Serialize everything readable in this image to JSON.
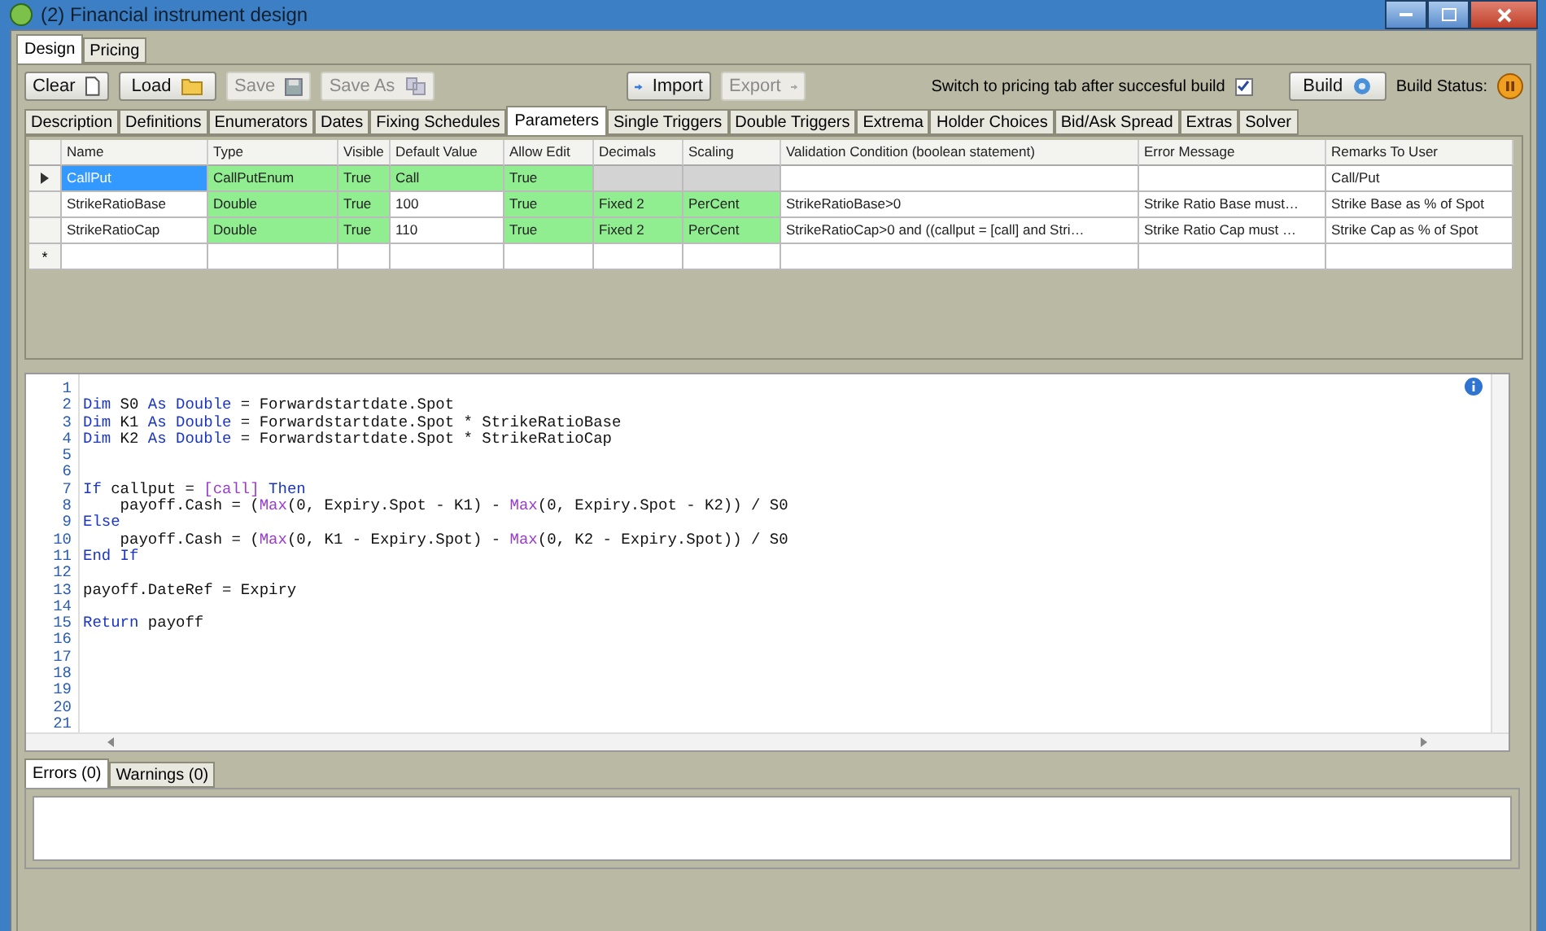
{
  "window": {
    "title": "(2) Financial instrument design"
  },
  "main_tabs": [
    {
      "label": "Design",
      "selected": true
    },
    {
      "label": "Pricing",
      "selected": false
    }
  ],
  "toolbar": {
    "buttons": [
      {
        "label": "Clear",
        "disabled": false
      },
      {
        "label": "Load",
        "disabled": false
      },
      {
        "label": "Save",
        "disabled": true
      },
      {
        "label": "Save As",
        "disabled": true
      },
      {
        "label": "Import",
        "disabled": false
      },
      {
        "label": "Export",
        "disabled": true
      }
    ],
    "switch_label": "Switch to pricing tab after succesful build",
    "switch_checked": true,
    "build_button": "Build",
    "build_status_label": "Build Status:"
  },
  "sub_tabs": [
    {
      "label": "Description",
      "selected": false
    },
    {
      "label": "Definitions",
      "selected": false
    },
    {
      "label": "Enumerators",
      "selected": false
    },
    {
      "label": "Dates",
      "selected": false
    },
    {
      "label": "Fixing Schedules",
      "selected": false
    },
    {
      "label": "Parameters",
      "selected": true
    },
    {
      "label": "Single Triggers",
      "selected": false
    },
    {
      "label": "Double Triggers",
      "selected": false
    },
    {
      "label": "Extrema",
      "selected": false
    },
    {
      "label": "Holder Choices",
      "selected": false
    },
    {
      "label": "Bid/Ask Spread",
      "selected": false
    },
    {
      "label": "Extras",
      "selected": false
    },
    {
      "label": "Solver",
      "selected": false
    }
  ],
  "grid": {
    "columns": [
      "Name",
      "Type",
      "Visible",
      "Default Value",
      "Allow Edit",
      "Decimals",
      "Scaling",
      "Validation Condition (boolean statement)",
      "Error Message",
      "Remarks To User"
    ],
    "rows": [
      {
        "selected": true,
        "cells": [
          {
            "text": "CallPut",
            "kind": "plain"
          },
          {
            "text": "CallPutEnum",
            "kind": "green"
          },
          {
            "text": "True",
            "kind": "green"
          },
          {
            "text": "Call",
            "kind": "green"
          },
          {
            "text": "True",
            "kind": "green"
          },
          {
            "kind": "grey"
          },
          {
            "kind": "grey"
          },
          {
            "kind": "plain"
          },
          {
            "kind": "plain"
          },
          {
            "text": "Call/Put",
            "kind": "plain"
          }
        ]
      },
      {
        "selected": false,
        "cells": [
          {
            "text": "StrikeRatioBase",
            "kind": "plain"
          },
          {
            "text": "Double",
            "kind": "green"
          },
          {
            "text": "True",
            "kind": "green"
          },
          {
            "text": "100",
            "kind": "plain"
          },
          {
            "text": "True",
            "kind": "green"
          },
          {
            "text": "Fixed 2",
            "kind": "green"
          },
          {
            "text": "PerCent",
            "kind": "green"
          },
          {
            "text": "StrikeRatioBase>0",
            "kind": "plain"
          },
          {
            "text": "Strike Ratio Base must…",
            "kind": "plain"
          },
          {
            "text": "Strike Base as % of Spot",
            "kind": "plain"
          }
        ]
      },
      {
        "selected": false,
        "cells": [
          {
            "text": "StrikeRatioCap",
            "kind": "plain"
          },
          {
            "text": "Double",
            "kind": "green"
          },
          {
            "text": "True",
            "kind": "green"
          },
          {
            "text": "110",
            "kind": "plain"
          },
          {
            "text": "True",
            "kind": "green"
          },
          {
            "text": "Fixed 2",
            "kind": "green"
          },
          {
            "text": "PerCent",
            "kind": "green"
          },
          {
            "text": "StrikeRatioCap>0 and ((callput = [call] and Stri…",
            "kind": "plain"
          },
          {
            "text": "Strike Ratio Cap must …",
            "kind": "plain"
          },
          {
            "text": "Strike Cap as % of Spot",
            "kind": "plain"
          }
        ]
      }
    ],
    "new_row_marker": "*"
  },
  "code": [
    {
      "number": "1"
    },
    {
      "number": "2",
      "tokens": [
        {
          "text": "Dim",
          "kind": "keyword"
        },
        {
          "text": " S0 ",
          "kind": "plain"
        },
        {
          "text": "As Double",
          "kind": "keyword"
        },
        {
          "text": " = Forwardstartdate.Spot",
          "kind": "plain"
        }
      ]
    },
    {
      "number": "3",
      "tokens": [
        {
          "text": "Dim",
          "kind": "keyword"
        },
        {
          "text": " K1 ",
          "kind": "plain"
        },
        {
          "text": "As Double",
          "kind": "keyword"
        },
        {
          "text": " = Forwardstartdate.Spot * StrikeRatioBase",
          "kind": "plain"
        }
      ]
    },
    {
      "number": "4",
      "tokens": [
        {
          "text": "Dim",
          "kind": "keyword"
        },
        {
          "text": " K2 ",
          "kind": "plain"
        },
        {
          "text": "As Double",
          "kind": "keyword"
        },
        {
          "text": " = Forwardstartdate.Spot * StrikeRatioCap",
          "kind": "plain"
        }
      ]
    },
    {
      "number": "5"
    },
    {
      "number": "6"
    },
    {
      "number": "7",
      "tokens": [
        {
          "text": "If",
          "kind": "keyword"
        },
        {
          "text": " callput = ",
          "kind": "plain"
        },
        {
          "text": "[call]",
          "kind": "enum"
        },
        {
          "text": " Then",
          "kind": "keyword"
        }
      ]
    },
    {
      "number": "8",
      "tokens": [
        {
          "text": "    payoff.Cash = (",
          "kind": "plain"
        },
        {
          "text": "Max",
          "kind": "enum"
        },
        {
          "text": "(0, Expiry.Spot - K1) - ",
          "kind": "plain"
        },
        {
          "text": "Max",
          "kind": "enum"
        },
        {
          "text": "(0, Expiry.Spot - K2)) / S0",
          "kind": "plain"
        }
      ]
    },
    {
      "number": "9",
      "tokens": [
        {
          "text": "Else",
          "kind": "keyword"
        }
      ]
    },
    {
      "number": "10",
      "tokens": [
        {
          "text": "    payoff.Cash = (",
          "kind": "plain"
        },
        {
          "text": "Max",
          "kind": "enum"
        },
        {
          "text": "(0, K1 - Expiry.Spot) - ",
          "kind": "plain"
        },
        {
          "text": "Max",
          "kind": "enum"
        },
        {
          "text": "(0, K2 - Expiry.Spot)) / S0",
          "kind": "plain"
        }
      ]
    },
    {
      "number": "11",
      "tokens": [
        {
          "text": "End If",
          "kind": "keyword"
        }
      ]
    },
    {
      "number": "12"
    },
    {
      "number": "13",
      "tokens": [
        {
          "text": "payoff.DateRef = Expiry",
          "kind": "plain"
        }
      ]
    },
    {
      "number": "14"
    },
    {
      "number": "15",
      "tokens": [
        {
          "text": "Return",
          "kind": "keyword"
        },
        {
          "text": " payoff",
          "kind": "plain"
        }
      ]
    },
    {
      "number": "16"
    },
    {
      "number": "17"
    },
    {
      "number": "18"
    },
    {
      "number": "19"
    },
    {
      "number": "20"
    },
    {
      "number": "21"
    }
  ],
  "output_tabs": [
    {
      "label": "Errors (0)",
      "selected": true
    },
    {
      "label": "Warnings (0)",
      "selected": false
    }
  ]
}
